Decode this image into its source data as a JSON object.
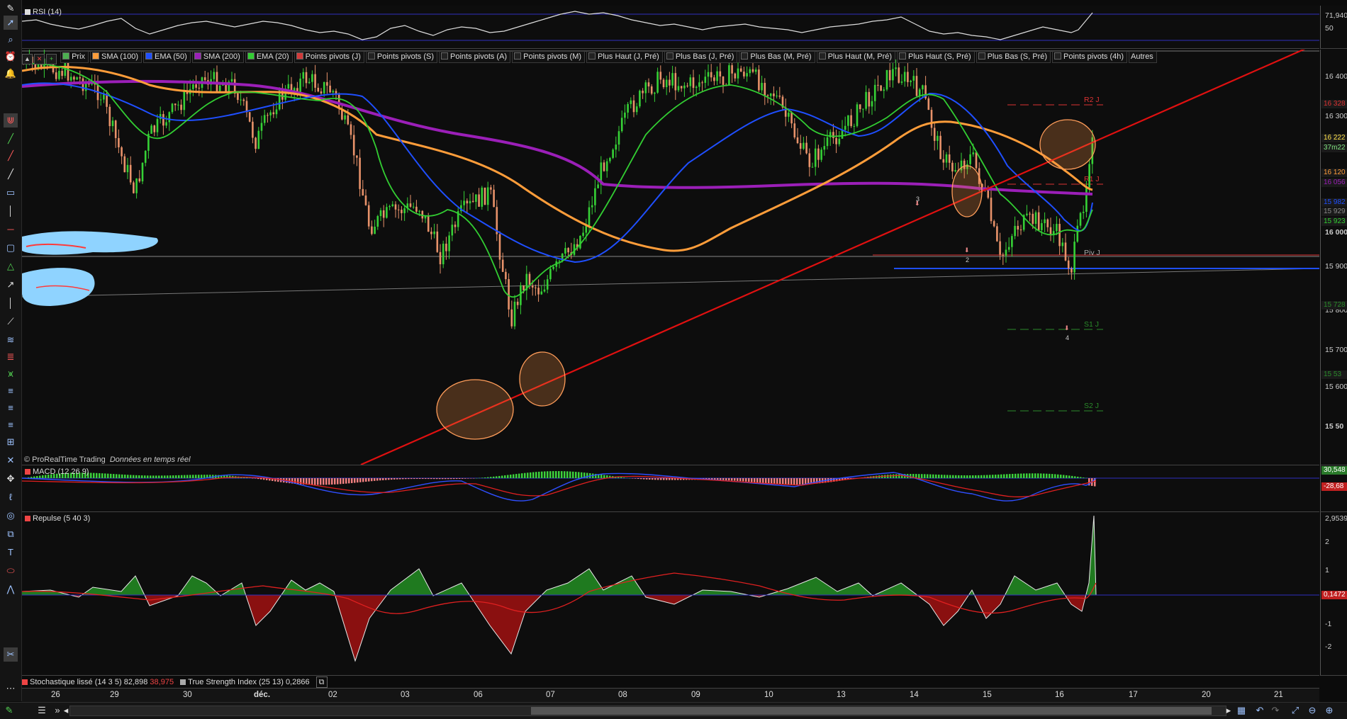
{
  "rsi": {
    "title": "RSI (14)",
    "axis": [
      "71,940",
      "50"
    ]
  },
  "main": {
    "legend": [
      {
        "label": "Prix",
        "color": "#4caf50"
      },
      {
        "label": "SMA (100)",
        "color": "#ff9d3a"
      },
      {
        "label": "EMA (50)",
        "color": "#1f4fff"
      },
      {
        "label": "SMA (200)",
        "color": "#9b1fb8"
      },
      {
        "label": "EMA (20)",
        "color": "#32cd32"
      },
      {
        "label": "Points pivots (J)",
        "color": "#d23a3a"
      },
      {
        "label": "Points pivots (S)",
        "color": "#222222"
      },
      {
        "label": "Points pivots (A)",
        "color": "#222222"
      },
      {
        "label": "Points pivots (M)",
        "color": "#222222"
      },
      {
        "label": "Plus Haut (J, Pré)",
        "color": "#222222"
      },
      {
        "label": "Plus Bas (J, Pré)",
        "color": "#222222"
      },
      {
        "label": "Plus Bas (M, Pré)",
        "color": "#222222"
      },
      {
        "label": "Plus Haut (M, Pré)",
        "color": "#222222"
      },
      {
        "label": "Plus Haut (S, Pré)",
        "color": "#222222"
      },
      {
        "label": "Plus Bas (S, Pré)",
        "color": "#222222"
      },
      {
        "label": "Points pivots (4h)",
        "color": "#222222"
      }
    ],
    "more_label": "Autres",
    "pivot_labels": [
      "R2 J",
      "R1 J",
      "Piv J",
      "S1 J",
      "S2 J"
    ],
    "markers": [
      "3",
      "2",
      "4"
    ],
    "axis_labels": [
      "16 400",
      "16 300",
      "16 000",
      "15 900",
      "15 800",
      "15 700",
      "15 600",
      "15 50"
    ],
    "axis_boxes": [
      {
        "text": "16 328",
        "color": "#d33"
      },
      {
        "text": "16 222",
        "color": "#ffe24a"
      },
      {
        "text": "37m22",
        "color": "#7fe37f"
      },
      {
        "text": "16 120",
        "color": "#ff9d3a"
      },
      {
        "text": "16 056",
        "color": "#9b1fb8"
      },
      {
        "text": "15 982",
        "color": "#1f4fff"
      },
      {
        "text": "15 929",
        "color": "#888"
      },
      {
        "text": "15 923",
        "color": "#32cd32"
      },
      {
        "text": "15 728",
        "color": "#2a8a2a"
      },
      {
        "text": "15 53",
        "color": "#2a8a2a"
      }
    ],
    "copyright": "© ProRealTime Trading",
    "realtime": "Données en temps réel"
  },
  "macd": {
    "title": "MACD (12 26 9)",
    "axis": [
      "30,548",
      "-28,68"
    ]
  },
  "repulse": {
    "title": "Repulse (5 40 3)",
    "axis": [
      "2,9539",
      "2",
      "1",
      "0,1472",
      "-1",
      "-2"
    ]
  },
  "bottom": {
    "stoch_label": "Stochastique lissé (14 3 5)",
    "stoch_v1": "82,898",
    "stoch_v2": "38,975",
    "tsi_label": "True Strength Index (25 13)",
    "tsi_v": "0,2866"
  },
  "xaxis": [
    "26",
    "29",
    "30",
    "déc.",
    "02",
    "03",
    "06",
    "07",
    "08",
    "09",
    "10",
    "13",
    "14",
    "15",
    "16",
    "17",
    "20",
    "21"
  ]
}
